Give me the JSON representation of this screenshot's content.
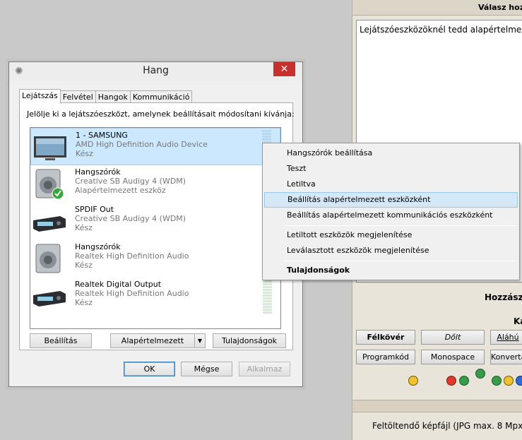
{
  "forum": {
    "header": "Válasz hozz",
    "textarea_text": "Lejátszóeszközöknél tedd alapértelmeze",
    "label_hozzasz": "Hozzász",
    "label_ka": "Ka",
    "buttons_row1": [
      "Félkövér",
      "Dőlt",
      "Aláhú"
    ],
    "buttons_row2": [
      "Programkód",
      "Monospace",
      "Konverta"
    ],
    "footer": "Feltöltendő képfájl (JPG max. 8 Mpx*"
  },
  "dialog": {
    "title": "Hang",
    "close_glyph": "✕",
    "tabs": [
      "Lejátszás",
      "Felvétel",
      "Hangok",
      "Kommunikáció"
    ],
    "instruction": "Jelölje ki a lejátszóeszközt, amelynek beállításait módosítani kívánja:",
    "devices": [
      {
        "name": "1 - SAMSUNG",
        "subtitle": "AMD High Definition Audio Device",
        "status": "Kész",
        "icon": "monitor-icon"
      },
      {
        "name": "Hangszórók",
        "subtitle": "Creative SB Audigy 4 (WDM)",
        "status": "Alapértelmezett eszköz",
        "icon": "speaker-default-icon"
      },
      {
        "name": "SPDIF Out",
        "subtitle": "Creative SB Audigy 4 (WDM)",
        "status": "Kész",
        "icon": "digital-out-icon"
      },
      {
        "name": "Hangszórók",
        "subtitle": "Realtek High Definition Audio",
        "status": "Kész",
        "icon": "speaker-icon"
      },
      {
        "name": "Realtek Digital Output",
        "subtitle": "Realtek High Definition Audio",
        "status": "Kész",
        "icon": "digital-out-icon"
      }
    ],
    "panel_buttons": {
      "configure": "Beállítás",
      "set_default": "Alapértelmezett",
      "properties": "Tulajdonságok"
    },
    "ok": "OK",
    "cancel": "Mégse",
    "apply": "Alkalmaz"
  },
  "context_menu": {
    "items": [
      "Hangszórók beállítása",
      "Teszt",
      "Letiltva",
      "Beállítás alapértelmezett eszközként",
      "Beállítás alapértelmezett kommunikációs eszközként",
      "Letiltott eszközök megjelenítése",
      "Leválasztott eszközök megjelenítése",
      "Tulajdonságok"
    ],
    "highlighted_index": 3
  },
  "colors": {
    "selection": "#cce8ff",
    "close_red": "#c7302b",
    "menu_highlight": "#d5e8f7"
  }
}
